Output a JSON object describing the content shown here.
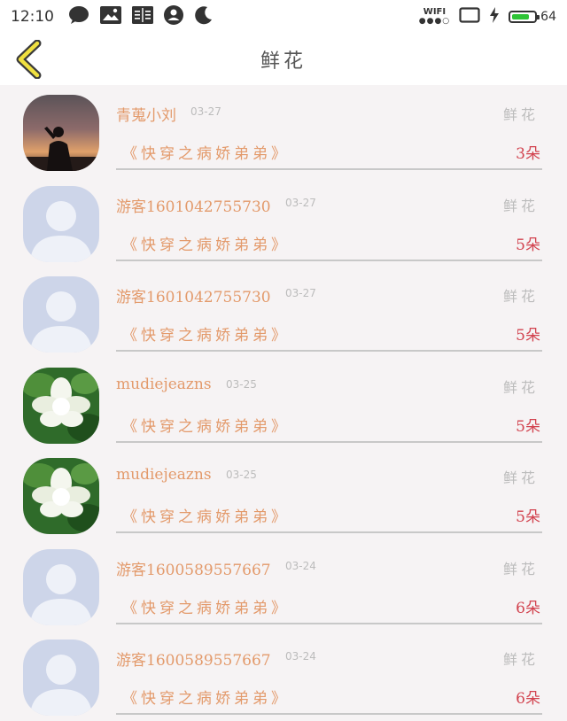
{
  "status_bar": {
    "time": "12:10",
    "wifi_label": "WIFI",
    "battery_level": "64",
    "battery_fill_fraction": 0.8,
    "battery_color": "#2ec436",
    "icons": [
      "chat-icon",
      "image-icon",
      "book-icon",
      "account-icon",
      "moon-icon",
      "wifi-icon",
      "screen-rotate-icon",
      "charging-icon",
      "battery-icon"
    ]
  },
  "header": {
    "title": "鲜花",
    "back_icon": "chevron-left-icon",
    "accent_color": "#f0e040"
  },
  "gift_label": "鲜花",
  "book_title": "《快穿之病娇弟弟》",
  "records": [
    {
      "name": "青蒐小刘",
      "date": "03-27",
      "count": "3朵",
      "avatar": "sunset-silhouette"
    },
    {
      "name": "游客1601042755730",
      "date": "03-27",
      "count": "5朵",
      "avatar": "default-avatar"
    },
    {
      "name": "游客1601042755730",
      "date": "03-27",
      "count": "5朵",
      "avatar": "default-avatar"
    },
    {
      "name": "mudiejeazns",
      "date": "03-25",
      "count": "5朵",
      "avatar": "white-flower"
    },
    {
      "name": "mudiejeazns",
      "date": "03-25",
      "count": "5朵",
      "avatar": "white-flower"
    },
    {
      "name": "游客1600589557667",
      "date": "03-24",
      "count": "6朵",
      "avatar": "default-avatar"
    },
    {
      "name": "游客1600589557667",
      "date": "03-24",
      "count": "6朵",
      "avatar": "default-avatar"
    }
  ]
}
